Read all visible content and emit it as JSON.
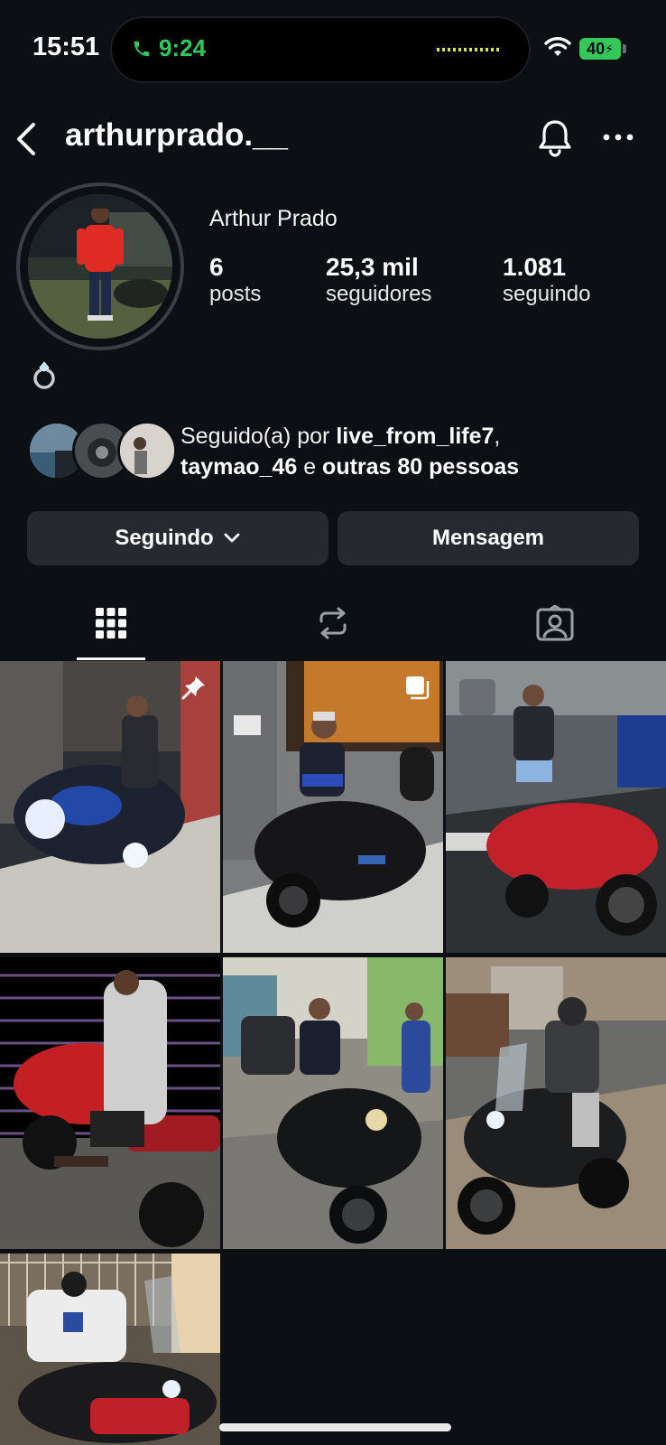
{
  "status_bar": {
    "time": "15:51",
    "call_time": "9:24",
    "battery": "40"
  },
  "header": {
    "username": "arthurprado.__"
  },
  "profile": {
    "full_name": "Arthur Prado",
    "stats": [
      {
        "value": "6",
        "label": "posts"
      },
      {
        "value": "25,3 mil",
        "label": "seguidores"
      },
      {
        "value": "1.081",
        "label": "seguindo"
      }
    ]
  },
  "followed_by": {
    "prefix": "Seguido(a) por ",
    "user1": "live_from_life7",
    "comma": ",",
    "user2": "taymao_46",
    "connector": " e ",
    "others": "outras 80 pessoas"
  },
  "buttons": {
    "following": "Seguindo",
    "message": "Mensagem"
  },
  "tabs": [
    "grid-icon",
    "reels-repost-icon",
    "tagged-icon"
  ],
  "colors": {
    "background": "#0c1014",
    "button": "#262a30",
    "call_green": "#34c759"
  }
}
